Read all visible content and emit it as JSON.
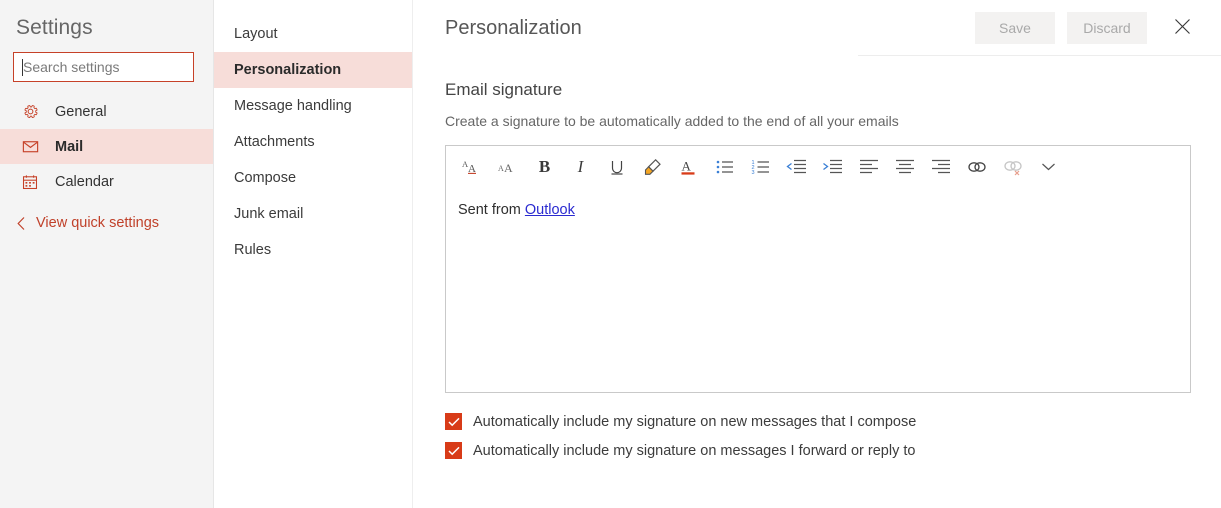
{
  "sidebar": {
    "title": "Settings",
    "search": {
      "placeholder": "Search settings",
      "value": ""
    },
    "items": [
      {
        "label": "General",
        "icon": "gear-icon",
        "selected": false
      },
      {
        "label": "Mail",
        "icon": "envelope-icon",
        "selected": true
      },
      {
        "label": "Calendar",
        "icon": "calendar-icon",
        "selected": false
      }
    ],
    "quick_settings_label": "View quick settings",
    "quick_settings_icon": "chevron-left-icon"
  },
  "midnav": {
    "items": [
      {
        "label": "Layout",
        "selected": false
      },
      {
        "label": "Personalization",
        "selected": true
      },
      {
        "label": "Message handling",
        "selected": false
      },
      {
        "label": "Attachments",
        "selected": false
      },
      {
        "label": "Compose",
        "selected": false
      },
      {
        "label": "Junk email",
        "selected": false
      },
      {
        "label": "Rules",
        "selected": false
      }
    ]
  },
  "header": {
    "title": "Personalization",
    "save_label": "Save",
    "discard_label": "Discard",
    "close_icon": "close-icon"
  },
  "main": {
    "section_title": "Email signature",
    "section_desc": "Create a signature to be automatically added to the end of all your emails",
    "editor": {
      "signature_text": "Sent from ",
      "signature_link": "Outlook",
      "toolbar": [
        {
          "name": "grow-font-icon",
          "title": "Grow font",
          "disabled": false
        },
        {
          "name": "shrink-font-icon",
          "title": "Shrink font",
          "disabled": false
        },
        {
          "name": "bold-icon",
          "title": "Bold",
          "disabled": false,
          "glyph": "B"
        },
        {
          "name": "italic-icon",
          "title": "Italic",
          "disabled": false,
          "glyph": "I"
        },
        {
          "name": "underline-icon",
          "title": "Underline",
          "disabled": false,
          "glyph": "U"
        },
        {
          "name": "highlight-icon",
          "title": "Highlight",
          "disabled": false
        },
        {
          "name": "font-color-icon",
          "title": "Font color",
          "disabled": false
        },
        {
          "name": "bulleted-list-icon",
          "title": "Bulleted list",
          "disabled": false
        },
        {
          "name": "numbered-list-icon",
          "title": "Numbered list",
          "disabled": false
        },
        {
          "name": "decrease-indent-icon",
          "title": "Decrease indent",
          "disabled": false
        },
        {
          "name": "increase-indent-icon",
          "title": "Increase indent",
          "disabled": false
        },
        {
          "name": "align-left-icon",
          "title": "Align left",
          "disabled": false
        },
        {
          "name": "align-center-icon",
          "title": "Align center",
          "disabled": false
        },
        {
          "name": "align-right-icon",
          "title": "Align right",
          "disabled": false
        },
        {
          "name": "insert-link-icon",
          "title": "Insert link",
          "disabled": false
        },
        {
          "name": "remove-link-icon",
          "title": "Remove link",
          "disabled": true
        },
        {
          "name": "chevron-down-icon",
          "title": "More options",
          "disabled": false
        }
      ]
    },
    "checkboxes": [
      {
        "label": "Automatically include my signature on new messages that I compose",
        "checked": true
      },
      {
        "label": "Automatically include my signature on messages I forward or reply to",
        "checked": true
      }
    ]
  },
  "colors": {
    "accent_red": "#c64128",
    "selected_bg": "#f7ddd9",
    "checkbox_fill": "#d83b18",
    "sidebar_bg": "#f4f4f4",
    "link_blue": "#2a2ad0",
    "button_bg": "#f3f2f1"
  }
}
